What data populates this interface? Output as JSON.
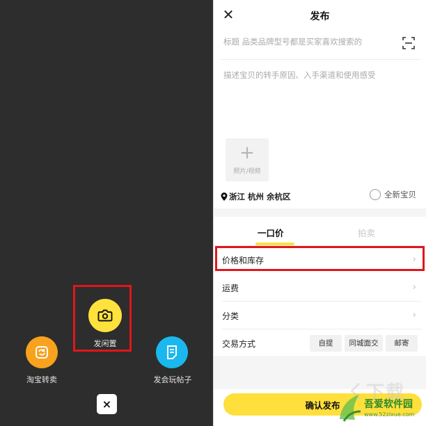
{
  "left_panel": {
    "actions": [
      {
        "label": "淘宝转卖",
        "icon": "refresh-icon",
        "color": "#f8a21d"
      },
      {
        "label": "发闲置",
        "icon": "camera-icon",
        "color": "#ffe33c"
      },
      {
        "label": "发会玩帖子",
        "icon": "document-icon",
        "color": "#1ab8ee"
      }
    ],
    "close_icon": "close-icon",
    "close_glyph": "×"
  },
  "publish_form": {
    "close_glyph": "✕",
    "title": "发布",
    "title_placeholder": "标题 品类品牌型号都是买家喜欢搜索的",
    "scan_icon": "scan-icon",
    "description_placeholder": "描述宝贝的转手原因、入手渠道和使用感受",
    "media_plus": "+",
    "media_label": "照片/视频",
    "location_icon": "location-pin-icon",
    "location": "浙江 杭州 余杭区",
    "brand_new_label": "全新宝贝",
    "tabs": [
      {
        "label": "一口价",
        "active": true
      },
      {
        "label": "拍卖",
        "active": false
      }
    ],
    "rows": [
      {
        "label": "价格和库存"
      },
      {
        "label": "运费"
      },
      {
        "label": "分类"
      }
    ],
    "chevron": "›",
    "trade_method": {
      "label": "交易方式",
      "options": [
        "自提",
        "同城面交",
        "邮寄"
      ]
    },
    "confirm_label": "确认发布",
    "accent_color": "#ffdf3c"
  },
  "highlight_color": "#e0161b",
  "watermark": {
    "faint_text": "ㄑ下载",
    "site_name": "吾爱软件园",
    "url": "www.52zixue.com"
  }
}
